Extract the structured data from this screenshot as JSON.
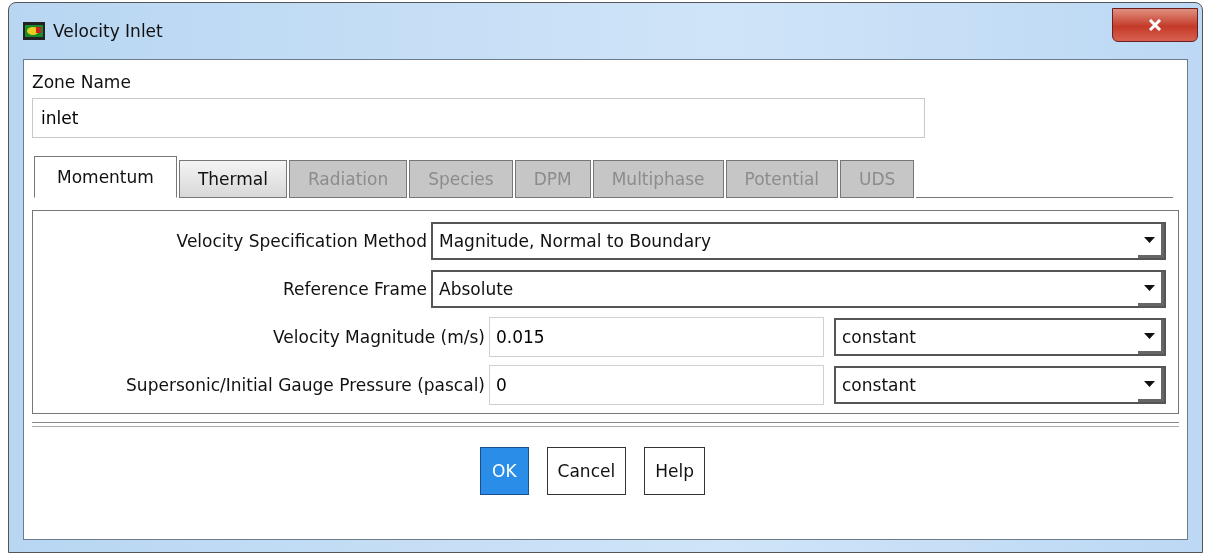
{
  "window": {
    "title": "Velocity Inlet"
  },
  "zone_name": {
    "label": "Zone Name",
    "value": "inlet"
  },
  "tabs": [
    {
      "label": "Momentum",
      "selected": true,
      "disabled": false
    },
    {
      "label": "Thermal",
      "selected": false,
      "disabled": false
    },
    {
      "label": "Radiation",
      "selected": false,
      "disabled": true
    },
    {
      "label": "Species",
      "selected": false,
      "disabled": true
    },
    {
      "label": "DPM",
      "selected": false,
      "disabled": true
    },
    {
      "label": "Multiphase",
      "selected": false,
      "disabled": true
    },
    {
      "label": "Potential",
      "selected": false,
      "disabled": true
    },
    {
      "label": "UDS",
      "selected": false,
      "disabled": true
    }
  ],
  "rows": [
    {
      "kind": "dropdown",
      "label": "Velocity Specification Method",
      "option": "Magnitude, Normal to Boundary"
    },
    {
      "kind": "dropdown",
      "label": "Reference Frame",
      "option": "Absolute"
    },
    {
      "kind": "value",
      "label": "Velocity Magnitude (m/s)",
      "value": "0.015",
      "option": "constant"
    },
    {
      "kind": "value",
      "label": "Supersonic/Initial Gauge Pressure (pascal)",
      "value": "0",
      "option": "constant"
    }
  ],
  "buttons": [
    {
      "label": "OK",
      "selected": true
    },
    {
      "label": "Cancel",
      "selected": false
    },
    {
      "label": "Help",
      "selected": false
    }
  ]
}
